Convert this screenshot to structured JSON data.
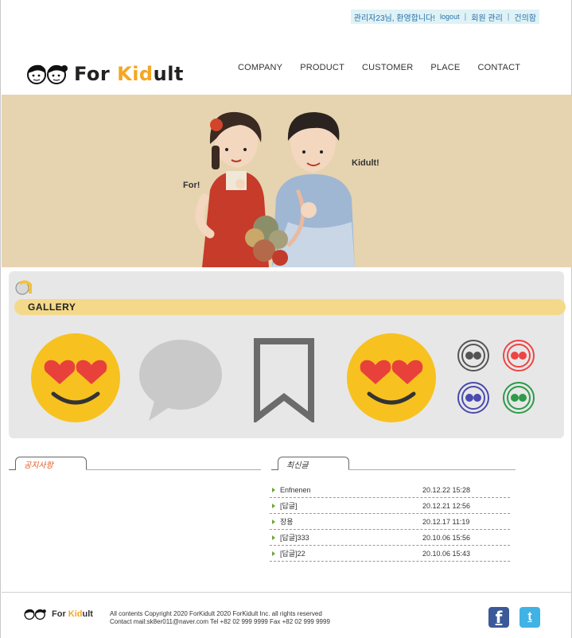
{
  "topbar": {
    "greeting": "관리자23님, 환영합니다!",
    "logout": "logout",
    "member_admin": "회원 관리",
    "suggestions": "건의함",
    "separator": "|"
  },
  "header": {
    "logo_for": "For ",
    "logo_kid": "Kid",
    "logo_ult": "ult",
    "nav": [
      {
        "label": "COMPANY"
      },
      {
        "label": "PRODUCT"
      },
      {
        "label": "CUSTOMER"
      },
      {
        "label": "PLACE"
      },
      {
        "label": "CONTACT"
      }
    ]
  },
  "hero": {
    "label_for": "For!",
    "label_kidult": "Kidult!",
    "background": "#e6d3b0"
  },
  "gallery": {
    "title": "GALLERY",
    "bar_color": "#f4d98a"
  },
  "boards": {
    "notice_tab": "공지사항",
    "recent_tab": "최신글",
    "recent_posts": [
      {
        "title": "Enfnenen",
        "date": "20.12.22 15:28"
      },
      {
        "title": "[답글]",
        "date": "20.12.21 12:56"
      },
      {
        "title": "장용",
        "date": "20.12.17 11:19"
      },
      {
        "title": "[답글]333",
        "date": "20.10.06 15:56"
      },
      {
        "title": "[답글]22",
        "date": "20.10.06 15:43"
      }
    ]
  },
  "footer": {
    "logo_for": "For ",
    "logo_kid": "Kid",
    "logo_ult": "ult",
    "copyright": "All contents Copyright 2020 ForKidult 2020 ForKidult Inc. all rights reserved",
    "contact": "Contact mail:sk8er011@naver.com Tel +82 02 999 9999 Fax +82 02 999 9999",
    "facebook_glyph": "f",
    "twitter_glyph": "t"
  },
  "colors": {
    "accent": "#f5a623",
    "notice": "#e05a1e",
    "arrow": "#6aa53a"
  }
}
